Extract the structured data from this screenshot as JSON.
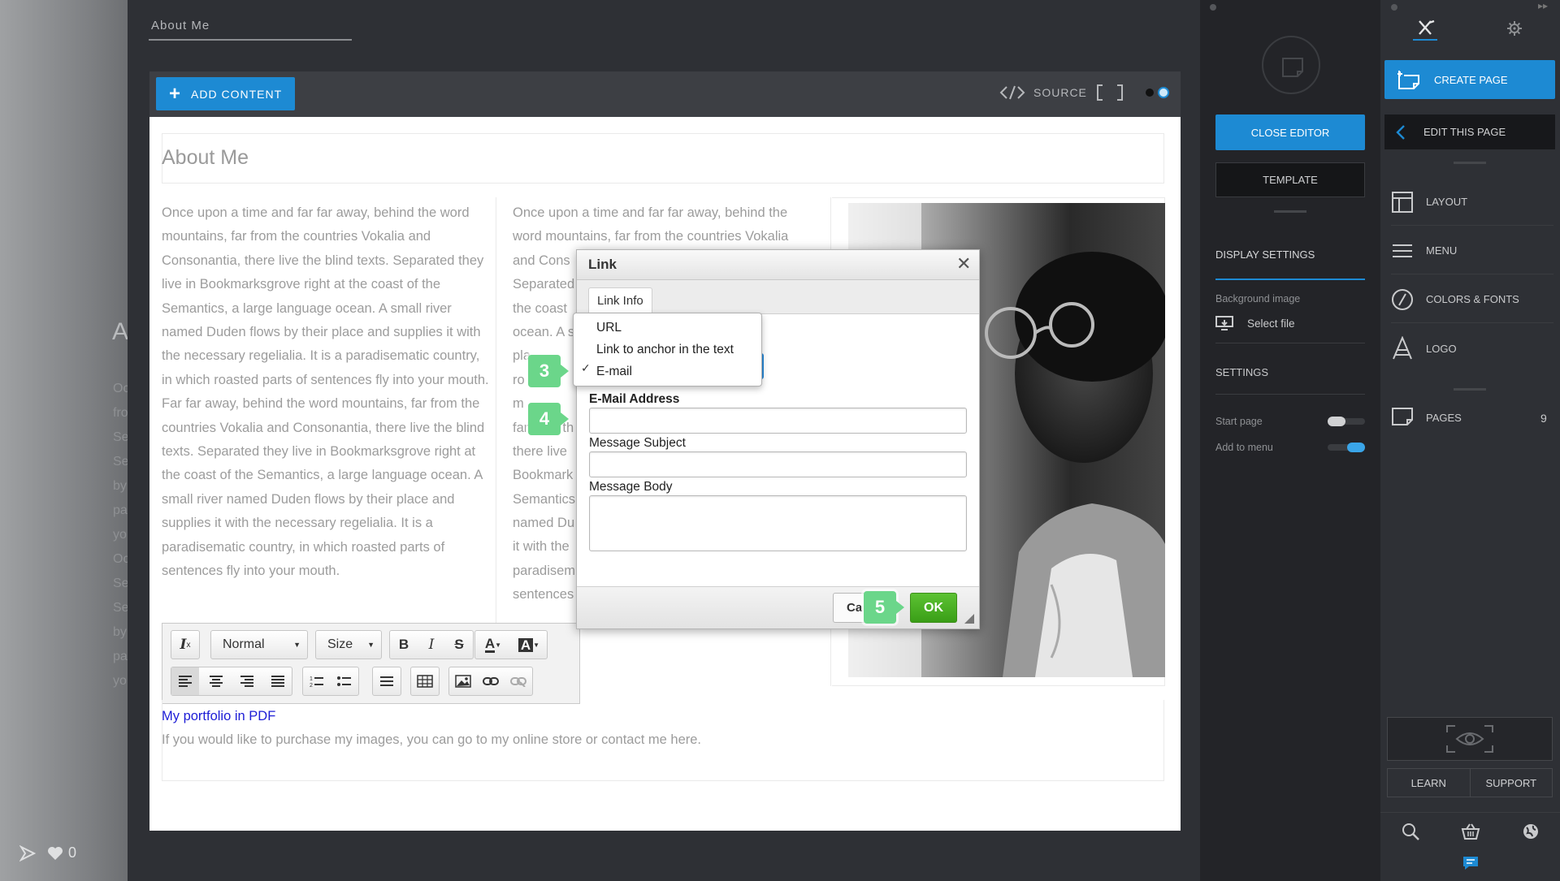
{
  "left_strip": {
    "ghost_letter": "A",
    "ghost_lines": [
      "Oc",
      "fro",
      "Se",
      "Se",
      "by",
      "pa",
      "yo",
      "Oc",
      "Se",
      "Se",
      "by",
      "pa",
      "yo"
    ],
    "likes": "0"
  },
  "page_tab": "About Me",
  "editor_toolbar": {
    "add_content": "ADD CONTENT",
    "source": "SOURCE"
  },
  "content": {
    "heading": "About Me",
    "col1_text": "Once upon a time and far far away, behind the word mountains, far from the countries Vokalia and Consonantia, there live the blind texts. Separated they live in Bookmarksgrove right at the coast of the Semantics, a large language ocean. A small river named Duden flows by their place and supplies it with the necessary regelialia. It is a paradisematic country, in which roasted parts of sentences fly into your mouth. Far far away, behind the word mountains, far from the countries Vokalia and Consonantia, there live the blind texts. Separated they live in Bookmarksgrove right at the coast of the Semantics, a large language ocean. A small river named Duden flows by their place and supplies it with the necessary regelialia.  It is a paradisematic country, in which roasted parts of sentences fly into your mouth.",
    "col2_lines": [
      "Once upon a time and far far away, behind the",
      "word mountains, far from the countries Vokalia",
      "and Cons",
      "Separated",
      "the coast",
      "ocean. A s",
      "pla",
      "ro",
      "m",
      "far from th",
      "there live",
      "Bookmark",
      "Semantics",
      "named Du",
      "it with the",
      "paradisem",
      "sentences"
    ],
    "portfolio_link": "My portfolio in PDF",
    "purchase_text": "If you would like to purchase my images, you can go to my online store or contact me here."
  },
  "rte": {
    "format_select": "Normal",
    "size_select": "Size"
  },
  "dialog": {
    "title": "Link",
    "tab": "Link Info",
    "link_type_options": [
      "URL",
      "Link to anchor in the text",
      "E-mail"
    ],
    "selected_check": "✓",
    "email_label": "E-Mail Address",
    "email_value": "",
    "subject_label": "Message Subject",
    "subject_value": "",
    "body_label": "Message Body",
    "body_value": "",
    "cancel": "Ca",
    "ok": "OK"
  },
  "badges": [
    "3",
    "4",
    "5"
  ],
  "settings_panel": {
    "close_editor": "CLOSE EDITOR",
    "template": "TEMPLATE",
    "display_settings": "DISPLAY SETTINGS",
    "background_image": "Background image",
    "select_file": "Select file",
    "settings": "SETTINGS",
    "start_page": "Start page",
    "add_to_menu": "Add to menu",
    "start_page_on": false,
    "add_to_menu_on": true
  },
  "nav_panel": {
    "create_page": "CREATE PAGE",
    "edit_this_page": "EDIT THIS PAGE",
    "items": [
      {
        "label": "LAYOUT",
        "icon": "layout-icon"
      },
      {
        "label": "MENU",
        "icon": "menu-icon"
      },
      {
        "label": "COLORS & FONTS",
        "icon": "colors-fonts-icon"
      },
      {
        "label": "LOGO",
        "icon": "logo-icon"
      }
    ],
    "pages": "PAGES",
    "pages_count": "9",
    "learn": "LEARN",
    "support": "SUPPORT"
  },
  "colors": {
    "accent": "#1d8ad3",
    "ok_green": "#4cb324",
    "badge_green": "#6bd68a"
  }
}
